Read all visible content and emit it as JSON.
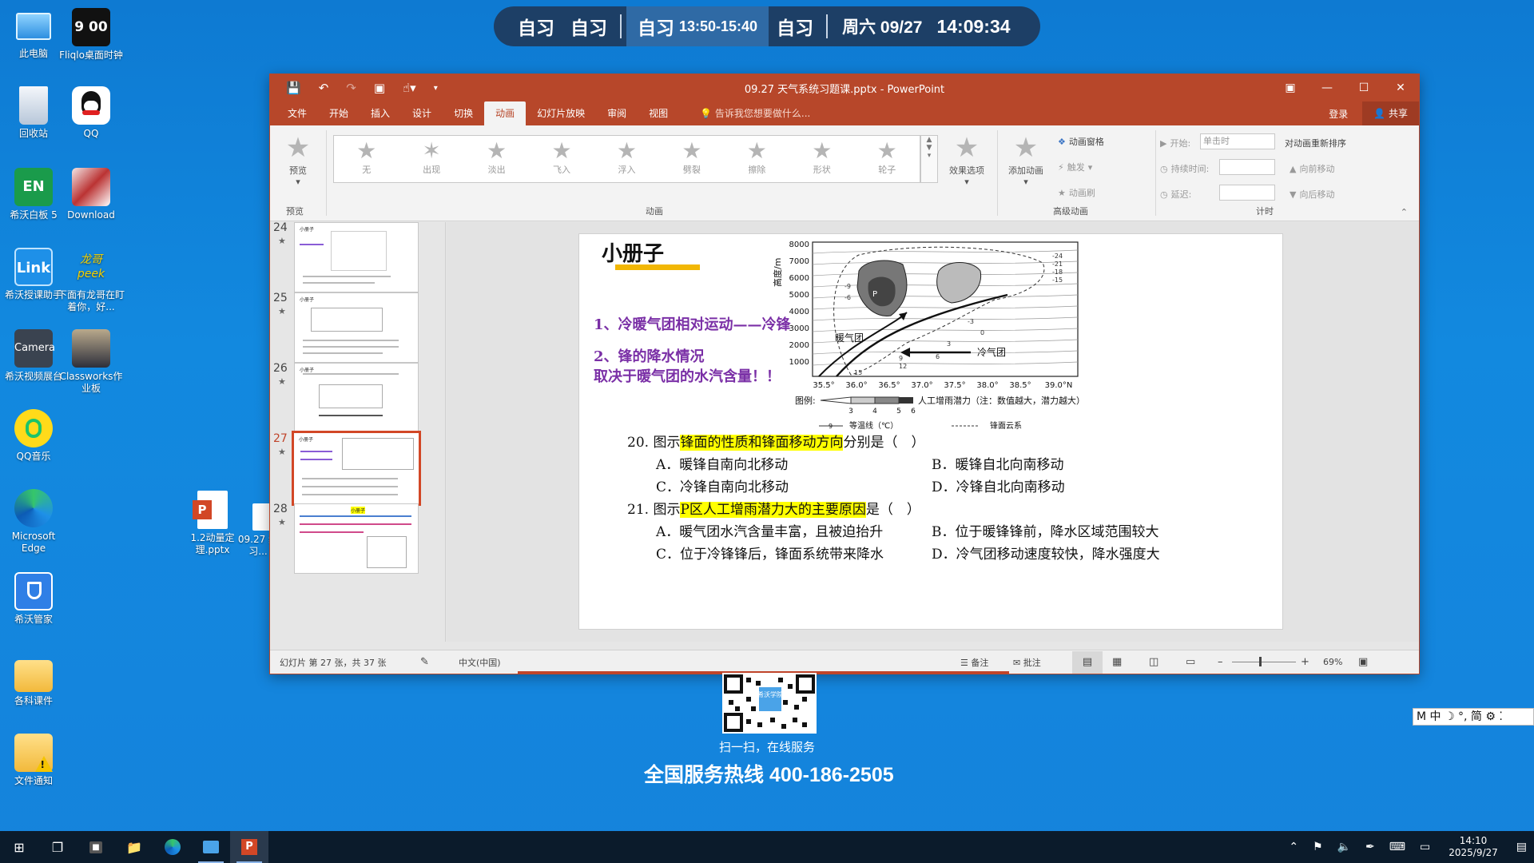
{
  "topbar": {
    "items": [
      "自习",
      "自习"
    ],
    "active_label": "自习",
    "active_time": "13:50-15:40",
    "next": "自习",
    "date": "周六 09/27",
    "time": "14:09:34"
  },
  "desktop_icons": [
    {
      "label": "此电脑",
      "icon": "computer-icon"
    },
    {
      "label": "Fliqlo桌面时钟",
      "icon": "clock-icon",
      "clock_text": "9 00"
    },
    {
      "label": "回收站",
      "icon": "recycle-bin-icon"
    },
    {
      "label": "QQ",
      "icon": "qq-icon"
    },
    {
      "label": "希沃白板 5",
      "icon": "whiteboard-icon",
      "badge": "EN"
    },
    {
      "label": "Download",
      "icon": "folder-image-icon"
    },
    {
      "label": "希沃授课助手",
      "icon": "link-icon",
      "badge": "Link"
    },
    {
      "label": "下面有龙哥在盯着你，好...",
      "icon": "peek-icon",
      "badge": "龙哥 peek"
    },
    {
      "label": "希沃视频展台",
      "icon": "camera-icon",
      "badge": "Camera"
    },
    {
      "label": "Classworks作业板",
      "icon": "person-photo-icon"
    },
    {
      "label": "QQ音乐",
      "icon": "qq-music-icon"
    },
    {
      "label": "Microsoft Edge",
      "icon": "edge-icon"
    },
    {
      "label": "1.2动量定理.pptx",
      "icon": "pptx-file-icon"
    },
    {
      "label": "09.27 统习...",
      "icon": "pptx-file-icon"
    },
    {
      "label": "希沃管家",
      "icon": "shield-icon"
    },
    {
      "label": "各科课件",
      "icon": "folder-icon"
    },
    {
      "label": "文件通知",
      "icon": "warning-folder-icon"
    }
  ],
  "ppt": {
    "title": "09.27 天气系统习题课.pptx - PowerPoint",
    "tabs": [
      "文件",
      "开始",
      "插入",
      "设计",
      "切换",
      "动画",
      "幻灯片放映",
      "审阅",
      "视图"
    ],
    "active_tab": "动画",
    "tell_me": "告诉我您想要做什么...",
    "login": "登录",
    "share": "共享",
    "ribbon": {
      "preview": "预览",
      "preview_group": "预览",
      "animations": [
        "无",
        "出现",
        "淡出",
        "飞入",
        "浮入",
        "劈裂",
        "擦除",
        "形状",
        "轮子"
      ],
      "animation_group": "动画",
      "effect_options": "效果选项",
      "add_animation": "添加动画",
      "animation_pane": "动画窗格",
      "trigger": "触发",
      "animation_painter": "动画刷",
      "advanced_group": "高级动画",
      "start_label": "开始:",
      "start_value": "单击时",
      "duration_label": "持续时间:",
      "delay_label": "延迟:",
      "reorder": "对动画重新排序",
      "move_earlier": "向前移动",
      "move_later": "向后移动",
      "timing_group": "计时"
    },
    "thumbnails": [
      {
        "num": "24",
        "tag": "小册子"
      },
      {
        "num": "25",
        "tag": "小册子"
      },
      {
        "num": "26",
        "tag": "小册子"
      },
      {
        "num": "27",
        "tag": "小册子"
      },
      {
        "num": "28",
        "tag": "小册子"
      }
    ],
    "slide": {
      "title": "小册子",
      "point1": "1、冷暖气团相对运动——冷锋",
      "point2a": "2、锋的降水情况",
      "point2b": "取决于暖气团的水汽含量！！",
      "chart": {
        "y_axis_label": "高度/m",
        "y_ticks": [
          "8000",
          "7000",
          "6000",
          "5000",
          "4000",
          "3000",
          "2000",
          "1000"
        ],
        "x_ticks": [
          "35.5°",
          "36.0°",
          "36.5°",
          "37.0°",
          "37.5°",
          "38.0°",
          "38.5°",
          "39.0°N"
        ],
        "warm_label": "暖气团",
        "cold_label": "冷气团",
        "p_label": "P",
        "isotherms": [
          "-24",
          "-21",
          "-18",
          "-15",
          "-9",
          "-6",
          "-3",
          "0",
          "3",
          "6",
          "9",
          "12",
          "15"
        ],
        "legend_title": "图例:",
        "legend_ticks": [
          "3",
          "4",
          "5",
          "6"
        ],
        "legend_desc": "人工增雨潜力（注：数值越大，潜力越大）",
        "isotherm_legend_sample": "9",
        "isotherm_legend": "等温线（℃）",
        "cloud_legend": "锋面云系"
      },
      "q20": {
        "num": "20.",
        "pre": "图示",
        "hl": "锋面的性质和锋面移动方向",
        "post": "分别是（　）"
      },
      "q20_options": [
        "A．暖锋自南向北移动",
        "B．暖锋自北向南移动",
        "C．冷锋自南向北移动",
        "D．冷锋自北向南移动"
      ],
      "q21": {
        "num": "21.",
        "pre": "图示",
        "hl": "P区人工增雨潜力大的主要原因",
        "post": "是（　）"
      },
      "q21_options": [
        "A．暖气团水汽含量丰富，且被迫抬升",
        "B．位于暖锋锋前，降水区域范围较大",
        "C．位于冷锋锋后，锋面系统带来降水",
        "D．冷气团移动速度较快，降水强度大"
      ]
    },
    "status": {
      "slide_info": "幻灯片 第 27 张，共 37 张",
      "language": "中文(中国)",
      "notes": "备注",
      "comments": "批注",
      "zoom": "69%"
    }
  },
  "qr": {
    "badge": "希沃学院",
    "scan_text": "扫一扫，在线服务",
    "hotline": "全国服务热线 400-186-2505"
  },
  "ime": {
    "text": "M 中 ☽ °, 简 ⚙ ⁚"
  },
  "taskbar": {
    "time": "14:10",
    "date": "2025/9/27"
  }
}
